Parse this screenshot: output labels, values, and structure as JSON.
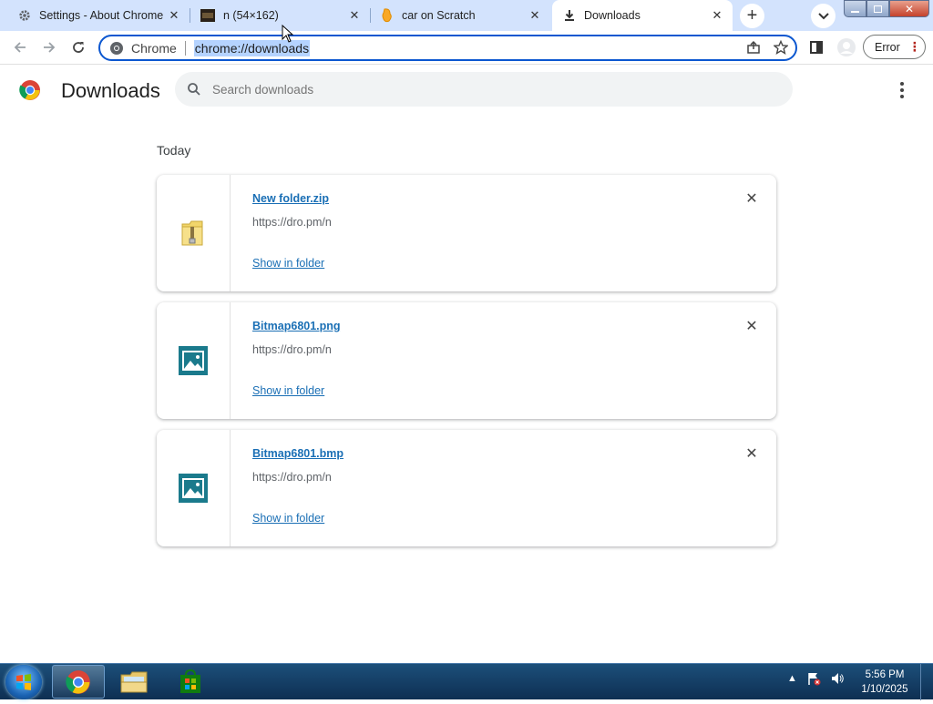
{
  "tabs": [
    {
      "title": "Settings - About Chrome",
      "icon": "gear-icon",
      "active": false
    },
    {
      "title": "n (54×162)",
      "icon": "image-thumbnail-icon",
      "active": false
    },
    {
      "title": "car on Scratch",
      "icon": "scratch-icon",
      "active": false
    },
    {
      "title": "Downloads",
      "icon": "download-icon",
      "active": true
    }
  ],
  "omnibox": {
    "scheme_label": "Chrome",
    "url": "chrome://downloads"
  },
  "profile": {
    "error_label": "Error"
  },
  "page": {
    "title": "Downloads",
    "search_placeholder": "Search downloads",
    "section_label": "Today"
  },
  "downloads": [
    {
      "name": "New folder.zip",
      "source": "https://dro.pm/n",
      "action": "Show in folder",
      "icon": "zip-folder-icon"
    },
    {
      "name": "Bitmap6801.png",
      "source": "https://dro.pm/n",
      "action": "Show in folder",
      "icon": "image-file-icon"
    },
    {
      "name": "Bitmap6801.bmp",
      "source": "https://dro.pm/n",
      "action": "Show in folder",
      "icon": "image-file-icon"
    }
  ],
  "taskbar": {
    "time": "5:56 PM",
    "date": "1/10/2025"
  },
  "colors": {
    "accent": "#0b57d0",
    "link": "#1a6fb5",
    "tabstrip": "#d3e3fd",
    "file_icon": "#1a7a8c"
  }
}
